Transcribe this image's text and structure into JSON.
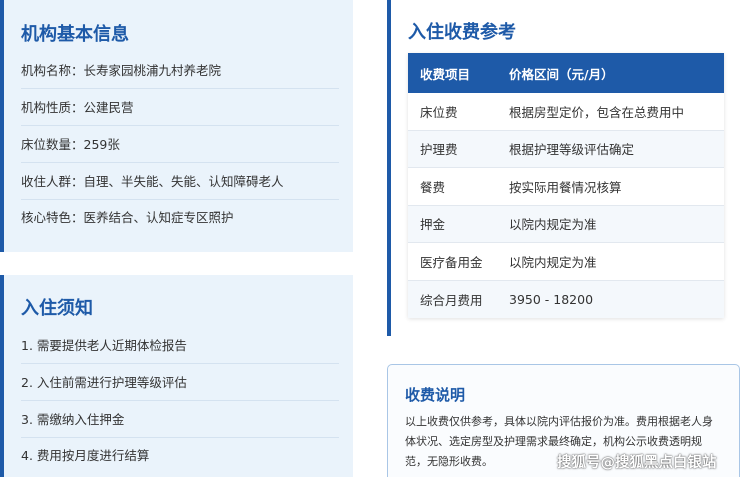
{
  "basic_info": {
    "title": "机构基本信息",
    "items": [
      "机构名称：长寿家园桃浦九村养老院",
      "机构性质：公建民营",
      "床位数量：259张",
      "收住人群：自理、半失能、失能、认知障碍老人",
      "核心特色：医养结合、认知症专区照护"
    ]
  },
  "admission_notice": {
    "title": "入住须知",
    "items": [
      "1. 需要提供老人近期体检报告",
      "2. 入住前需进行护理等级评估",
      "3. 需缴纳入住押金",
      "4. 费用按月度进行结算"
    ]
  },
  "fees": {
    "title": "入住收费参考",
    "headers": [
      "收费项目",
      "价格区间（元/月）"
    ],
    "rows": [
      [
        "床位费",
        "根据房型定价，包含在总费用中"
      ],
      [
        "护理费",
        "根据护理等级评估确定"
      ],
      [
        "餐费",
        "按实际用餐情况核算"
      ],
      [
        "押金",
        "以院内规定为准"
      ],
      [
        "医疗备用金",
        "以院内规定为准"
      ],
      [
        "综合月费用",
        "3950 - 18200"
      ]
    ]
  },
  "fee_note": {
    "title": "收费说明",
    "lines": [
      "以上收费仅供参考，具体以院内评估报价为准。费用根据老人身",
      "体状况、选定房型及护理需求最终确定，机构公示收费透明规",
      "范，无隐形收费。"
    ]
  },
  "watermark": "搜狐号@搜狐黑点白银站",
  "colors": {
    "accent": "#1e5aa8",
    "panel_bg": "#eaf3fb"
  }
}
